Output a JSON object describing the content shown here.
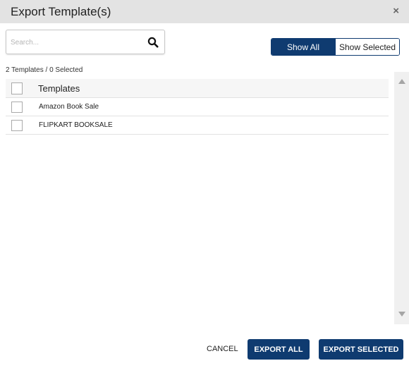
{
  "dialog": {
    "title": "Export Template(s)",
    "close_label": "×"
  },
  "search": {
    "placeholder": "Search...",
    "value": "",
    "icon": "search-icon"
  },
  "filter_toggle": {
    "show_all_label": "Show All",
    "show_selected_label": "Show Selected",
    "active": "Show All"
  },
  "summary": {
    "text": "2 Templates / 0 Selected"
  },
  "table": {
    "header": "Templates",
    "rows": [
      {
        "name": "Amazon Book Sale",
        "checked": false
      },
      {
        "name": "FLIPKART BOOKSALE",
        "checked": false
      }
    ]
  },
  "footer": {
    "cancel_label": "CANCEL",
    "export_all_label": "EXPORT ALL",
    "export_selected_label": "EXPORT SELECTED"
  },
  "colors": {
    "primary": "#0f3b70",
    "titlebar": "#e3e3e3"
  }
}
